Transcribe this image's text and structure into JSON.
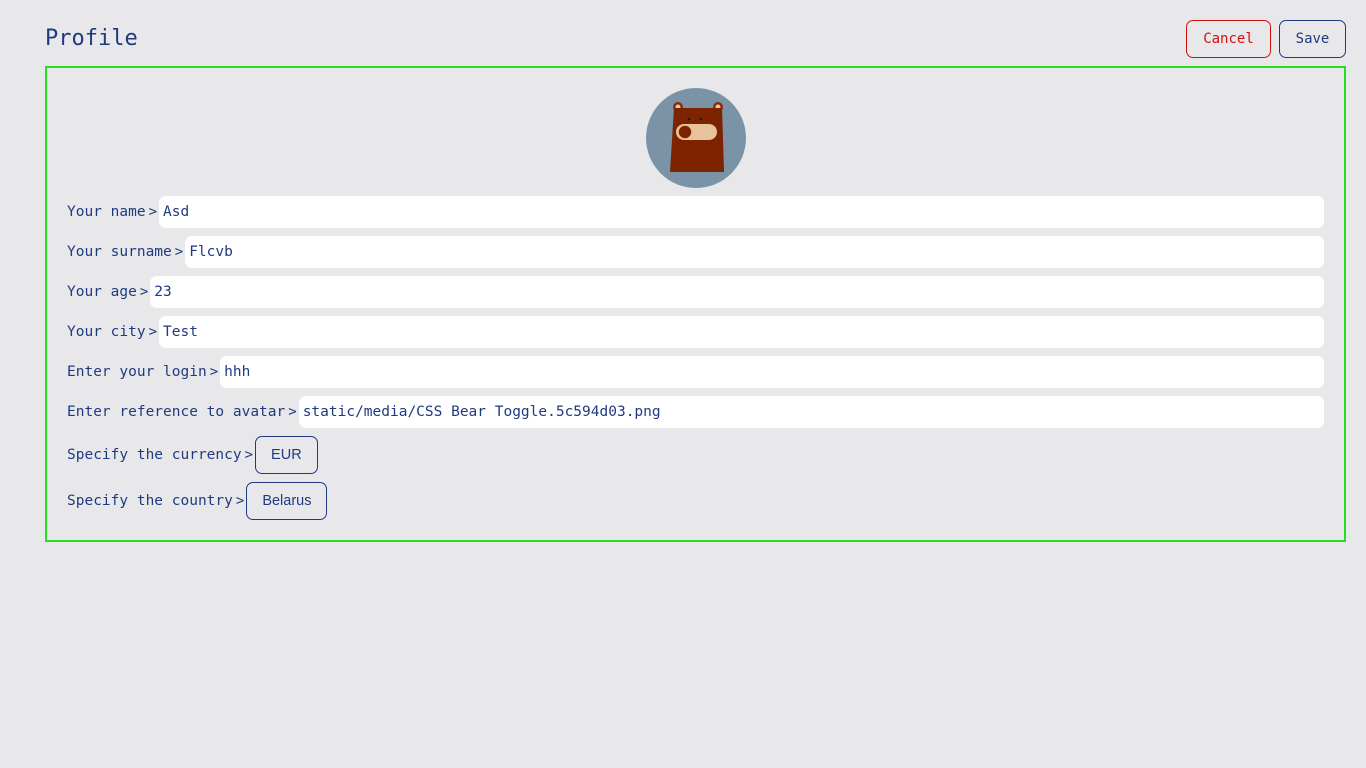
{
  "header": {
    "title": "Profile",
    "cancel_label": "Cancel",
    "save_label": "Save"
  },
  "avatar": {
    "icon": "bear-toggle-avatar",
    "bg_color": "#7a93a6"
  },
  "fields": {
    "name": {
      "label": "Your name",
      "value": "Asd"
    },
    "surname": {
      "label": "Your surname",
      "value": "Flcvb"
    },
    "age": {
      "label": "Your age",
      "value": "23"
    },
    "city": {
      "label": "Your city",
      "value": "Test"
    },
    "login": {
      "label": "Enter your login",
      "value": "hhh"
    },
    "avatar_ref": {
      "label": "Enter reference to avatar",
      "value": "static/media/CSS Bear Toggle.5c594d03.png"
    }
  },
  "currency": {
    "label": "Specify the currency",
    "value": "EUR"
  },
  "country": {
    "label": "Specify the country",
    "value": "Belarus"
  },
  "arrow": ">",
  "colors": {
    "accent": "#1f3a80",
    "danger": "#d01010",
    "frame": "#22e022",
    "background": "#e8e8ea"
  }
}
